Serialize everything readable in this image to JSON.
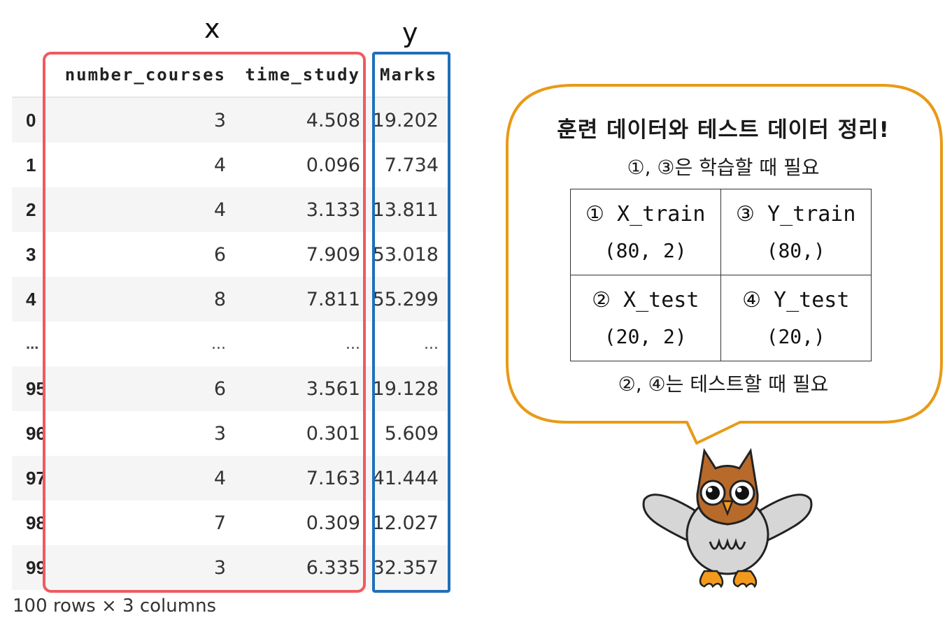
{
  "labels": {
    "x": "x",
    "y": "y"
  },
  "table": {
    "columns": [
      "number_courses",
      "time_study",
      "Marks"
    ],
    "rows": [
      {
        "index": "0",
        "number_courses": "3",
        "time_study": "4.508",
        "marks": "19.202"
      },
      {
        "index": "1",
        "number_courses": "4",
        "time_study": "0.096",
        "marks": "7.734"
      },
      {
        "index": "2",
        "number_courses": "4",
        "time_study": "3.133",
        "marks": "13.811"
      },
      {
        "index": "3",
        "number_courses": "6",
        "time_study": "7.909",
        "marks": "53.018"
      },
      {
        "index": "4",
        "number_courses": "8",
        "time_study": "7.811",
        "marks": "55.299"
      },
      {
        "index": "...",
        "number_courses": "...",
        "time_study": "...",
        "marks": "..."
      },
      {
        "index": "95",
        "number_courses": "6",
        "time_study": "3.561",
        "marks": "19.128"
      },
      {
        "index": "96",
        "number_courses": "3",
        "time_study": "0.301",
        "marks": "5.609"
      },
      {
        "index": "97",
        "number_courses": "4",
        "time_study": "7.163",
        "marks": "41.444"
      },
      {
        "index": "98",
        "number_courses": "7",
        "time_study": "0.309",
        "marks": "12.027"
      },
      {
        "index": "99",
        "number_courses": "3",
        "time_study": "6.335",
        "marks": "32.357"
      }
    ],
    "footer": "100 rows × 3 columns"
  },
  "bubble": {
    "title": "훈련 데이터와 테스트 데이터 정리!",
    "note_top": "①, ③은 학습할 때 필요",
    "note_bottom": "②, ④는 테스트할 때 필요",
    "cells": [
      {
        "name": "① X_train",
        "shape": "(80, 2)"
      },
      {
        "name": "③ Y_train",
        "shape": "(80,)"
      },
      {
        "name": "② X_test",
        "shape": "(20, 2)"
      },
      {
        "name": "④ Y_test",
        "shape": "(20,)"
      }
    ]
  },
  "colors": {
    "x_box": "#ef5a60",
    "y_box": "#1f6fb8",
    "bubble_border": "#e89a17",
    "owl_brown": "#b86a2b",
    "owl_orange": "#f39a1e",
    "owl_gray": "#d6d6d6"
  },
  "mascot": "owl-icon"
}
